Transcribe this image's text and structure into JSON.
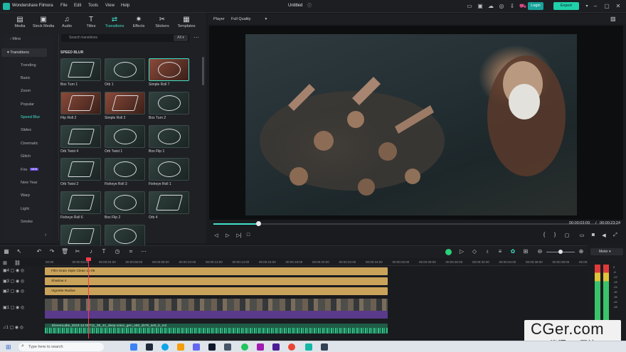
{
  "app": {
    "name": "Wondershare Filmora",
    "doc_title": "Untitled",
    "menus": [
      "File",
      "Edit",
      "Tools",
      "View",
      "Help"
    ],
    "login": "Login",
    "export": "Export"
  },
  "tabs": [
    {
      "label": "Media",
      "icon": "media-icon"
    },
    {
      "label": "Stock Media",
      "icon": "stock-media-icon"
    },
    {
      "label": "Audio",
      "icon": "audio-icon"
    },
    {
      "label": "Titles",
      "icon": "titles-icon"
    },
    {
      "label": "Transitions",
      "icon": "transitions-icon"
    },
    {
      "label": "Effects",
      "icon": "effects-icon"
    },
    {
      "label": "Stickers",
      "icon": "stickers-icon"
    },
    {
      "label": "Templates",
      "icon": "templates-icon"
    }
  ],
  "categories": {
    "mine": "Mine",
    "header": "Transitions",
    "items": [
      "Trending",
      "Basic",
      "Zoom",
      "Popular",
      "Speed Blur",
      "Slides",
      "Cinematic",
      "Glitch",
      "Fire",
      "New Year",
      "Warp",
      "Light",
      "Smoke"
    ],
    "selected": "Speed Blur",
    "fire_badge": "NEW"
  },
  "search": {
    "placeholder": "Search transitions",
    "filter": "All"
  },
  "section_title": "SPEED BLUR",
  "transitions": [
    "Box Turn 1",
    "Orb 1",
    "Simple Roll 7",
    "Flip Roll 2",
    "Simple Roll 2",
    "Box Turn 2",
    "Orb Twist 4",
    "Orb Twist 1",
    "Box Flip 1",
    "Orb Twist 2",
    "Fisheye Roll 3",
    "Fisheye Roll 1",
    "Fisheye Roll 6",
    "Box Flip 2",
    "Orb 4",
    "",
    ""
  ],
  "player": {
    "label": "Player",
    "quality": "Full Quality",
    "current": "00:00:03:09",
    "total": "00:00:23:24",
    "separator": "/",
    "progress_fraction": 0.11
  },
  "ruler": [
    "00:00",
    "00:00:02:00",
    "00:00:04:00",
    "00:00:06:00",
    "00:00:08:00",
    "00:00:10:00",
    "00:00:12:00",
    "00:00:14:00",
    "00:00:16:00",
    "00:00:18:00",
    "00:00:20:00",
    "00:00:22:00",
    "00:00:24:00",
    "00:00:26:00",
    "00:00:28:00",
    "00:00:30:00",
    "00:00:32:00",
    "00:00:34:00",
    "00:00:36:00",
    "00:00:38:00",
    "00:00:40:00"
  ],
  "tracks": {
    "clip1": "Film Grain Style Clean 1p 05",
    "clip2": "Shadow 4",
    "clip3": "Vignette Radius",
    "audio": "ElevenLabs_2023-12-05T11_35_41_deep voice_gen_s50_sb75_se0_b_m2",
    "labels": [
      "4",
      "3",
      "2",
      "1",
      "1"
    ]
  },
  "meter": {
    "label": "Meter"
  },
  "taskbar": {
    "search": "Type here to search"
  },
  "watermark": {
    "line1": "CGer.com",
    "line2": "CG资源 CG网站"
  }
}
